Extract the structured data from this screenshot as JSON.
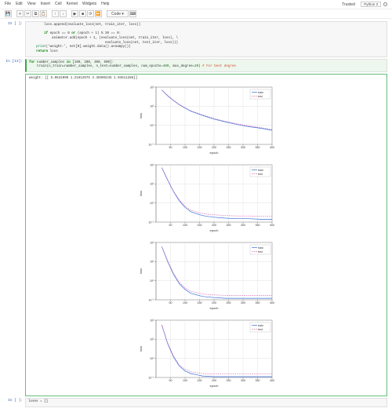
{
  "menu": {
    "items": [
      "File",
      "Edit",
      "View",
      "Insert",
      "Cell",
      "Kernel",
      "Widgets",
      "Help"
    ]
  },
  "toolbar": {
    "save": "💾",
    "add": "＋",
    "cut": "✂",
    "copy": "⧉",
    "paste": "📋",
    "up": "↑",
    "down": "↓",
    "run": "▶",
    "stop": "■",
    "restart": "⟳",
    "ff": "⏩",
    "mode": "Code",
    "keyboard": "⌨",
    "kernel": "Python 3"
  },
  "trusted": "Trusted",
  "code_cell": {
    "prompt": "In [  ]:",
    "lines": [
      {
        "pre": "        ",
        "body": "loss.append(evaluate_loss(net, train_iter, loss))"
      },
      {
        "pre": "",
        "body": ""
      },
      {
        "pre": "        ",
        "kw": "if",
        "body": " epoch == 0 ",
        "kw2": "or",
        "body2": " (epoch + 1) % 20 == 0:"
      },
      {
        "pre": "            ",
        "body": "animator.add(epoch + 1, (evaluate_loss(net, train_iter, loss), \\"
      },
      {
        "pre": "                                       ",
        "body": "evaluate_loss(net, test_iter, loss)))"
      },
      {
        "pre": "    ",
        "bi": "print",
        "body": "('weight:', net[0].weight.data().asnumpy())"
      },
      {
        "pre": "    ",
        "kw": "return",
        "body": " loss"
      }
    ]
  },
  "run_cell": {
    "prompt": "In [13]:",
    "line1a": "for",
    "line1b": " number_samples ",
    "line1c": "in",
    "line1d": " [100, 200, 300, 500]:",
    "line2a": "    train(n_train=number_samples, n_test=number_samples, num_epochs=",
    "line2b": "400",
    "line2c": ", max_degree=",
    "line2d": "20",
    "line2e": ") ",
    "comment": "# For best degree"
  },
  "output_text": "weight: [[ 5.0631099   1.21812675   3.35995245   1.04511288]]",
  "chart_common": {
    "xlabel": "epoch",
    "ylabel": "loss",
    "xticks": [
      50,
      100,
      150,
      200,
      250,
      300,
      350,
      400
    ],
    "yticks_labels": [
      "10⁻¹",
      "10⁰",
      "10¹",
      "10²"
    ],
    "legend": [
      "train",
      "test"
    ]
  },
  "chart_data": [
    {
      "type": "line",
      "title": "",
      "xlabel": "epoch",
      "ylabel": "loss",
      "xlim": [
        0,
        400
      ],
      "ylim_log": [
        -1,
        2
      ],
      "series": [
        {
          "name": "train",
          "x": [
            20,
            40,
            60,
            80,
            100,
            120,
            160,
            200,
            240,
            280,
            320,
            360,
            400
          ],
          "y": [
            70,
            35,
            20,
            12,
            8,
            5.5,
            3.3,
            2.1,
            1.5,
            1.1,
            0.85,
            0.7,
            0.55
          ]
        },
        {
          "name": "test",
          "x": [
            20,
            40,
            60,
            80,
            100,
            120,
            160,
            200,
            240,
            280,
            320,
            360,
            400
          ],
          "y": [
            72,
            37,
            21,
            12.5,
            8.4,
            5.8,
            3.5,
            2.3,
            1.6,
            1.2,
            0.92,
            0.76,
            0.6
          ]
        }
      ]
    },
    {
      "type": "line",
      "title": "",
      "xlabel": "epoch",
      "ylabel": "loss",
      "xlim": [
        0,
        400
      ],
      "ylim_log": [
        -1,
        2
      ],
      "series": [
        {
          "name": "train",
          "x": [
            20,
            40,
            60,
            80,
            100,
            120,
            160,
            200,
            240,
            280,
            320,
            360,
            400
          ],
          "y": [
            70,
            16,
            4,
            1.3,
            0.6,
            0.35,
            0.22,
            0.18,
            0.16,
            0.15,
            0.15,
            0.14,
            0.14
          ]
        },
        {
          "name": "test",
          "x": [
            20,
            40,
            60,
            80,
            100,
            120,
            160,
            200,
            240,
            280,
            320,
            360,
            400
          ],
          "y": [
            72,
            17,
            4.3,
            1.5,
            0.7,
            0.42,
            0.28,
            0.24,
            0.22,
            0.21,
            0.21,
            0.2,
            0.2
          ]
        }
      ]
    },
    {
      "type": "line",
      "title": "",
      "xlabel": "epoch",
      "ylabel": "loss",
      "xlim": [
        0,
        400
      ],
      "ylim_log": [
        -1,
        2
      ],
      "series": [
        {
          "name": "train",
          "x": [
            20,
            40,
            60,
            80,
            100,
            120,
            160,
            200,
            240,
            280,
            320,
            360,
            400
          ],
          "y": [
            60,
            10,
            2.2,
            0.7,
            0.35,
            0.22,
            0.15,
            0.13,
            0.12,
            0.12,
            0.12,
            0.12,
            0.12
          ]
        },
        {
          "name": "test",
          "x": [
            20,
            40,
            60,
            80,
            100,
            120,
            160,
            200,
            240,
            280,
            320,
            360,
            400
          ],
          "y": [
            62,
            11,
            2.5,
            0.82,
            0.42,
            0.28,
            0.2,
            0.18,
            0.17,
            0.17,
            0.17,
            0.17,
            0.17
          ]
        }
      ]
    },
    {
      "type": "line",
      "title": "",
      "xlabel": "epoch",
      "ylabel": "loss",
      "xlim": [
        0,
        400
      ],
      "ylim_log": [
        -1,
        2
      ],
      "series": [
        {
          "name": "train",
          "x": [
            20,
            40,
            60,
            80,
            100,
            120,
            160,
            200,
            240,
            280,
            320,
            360,
            400
          ],
          "y": [
            55,
            6,
            1.2,
            0.4,
            0.22,
            0.16,
            0.12,
            0.11,
            0.11,
            0.11,
            0.11,
            0.11,
            0.11
          ]
        },
        {
          "name": "test",
          "x": [
            20,
            40,
            60,
            80,
            100,
            120,
            160,
            200,
            240,
            280,
            320,
            360,
            400
          ],
          "y": [
            57,
            6.5,
            1.35,
            0.46,
            0.27,
            0.2,
            0.16,
            0.15,
            0.15,
            0.15,
            0.15,
            0.15,
            0.15
          ]
        }
      ]
    }
  ],
  "last_cell": {
    "prompt": "In [ ]:",
    "code": "loses = []"
  }
}
